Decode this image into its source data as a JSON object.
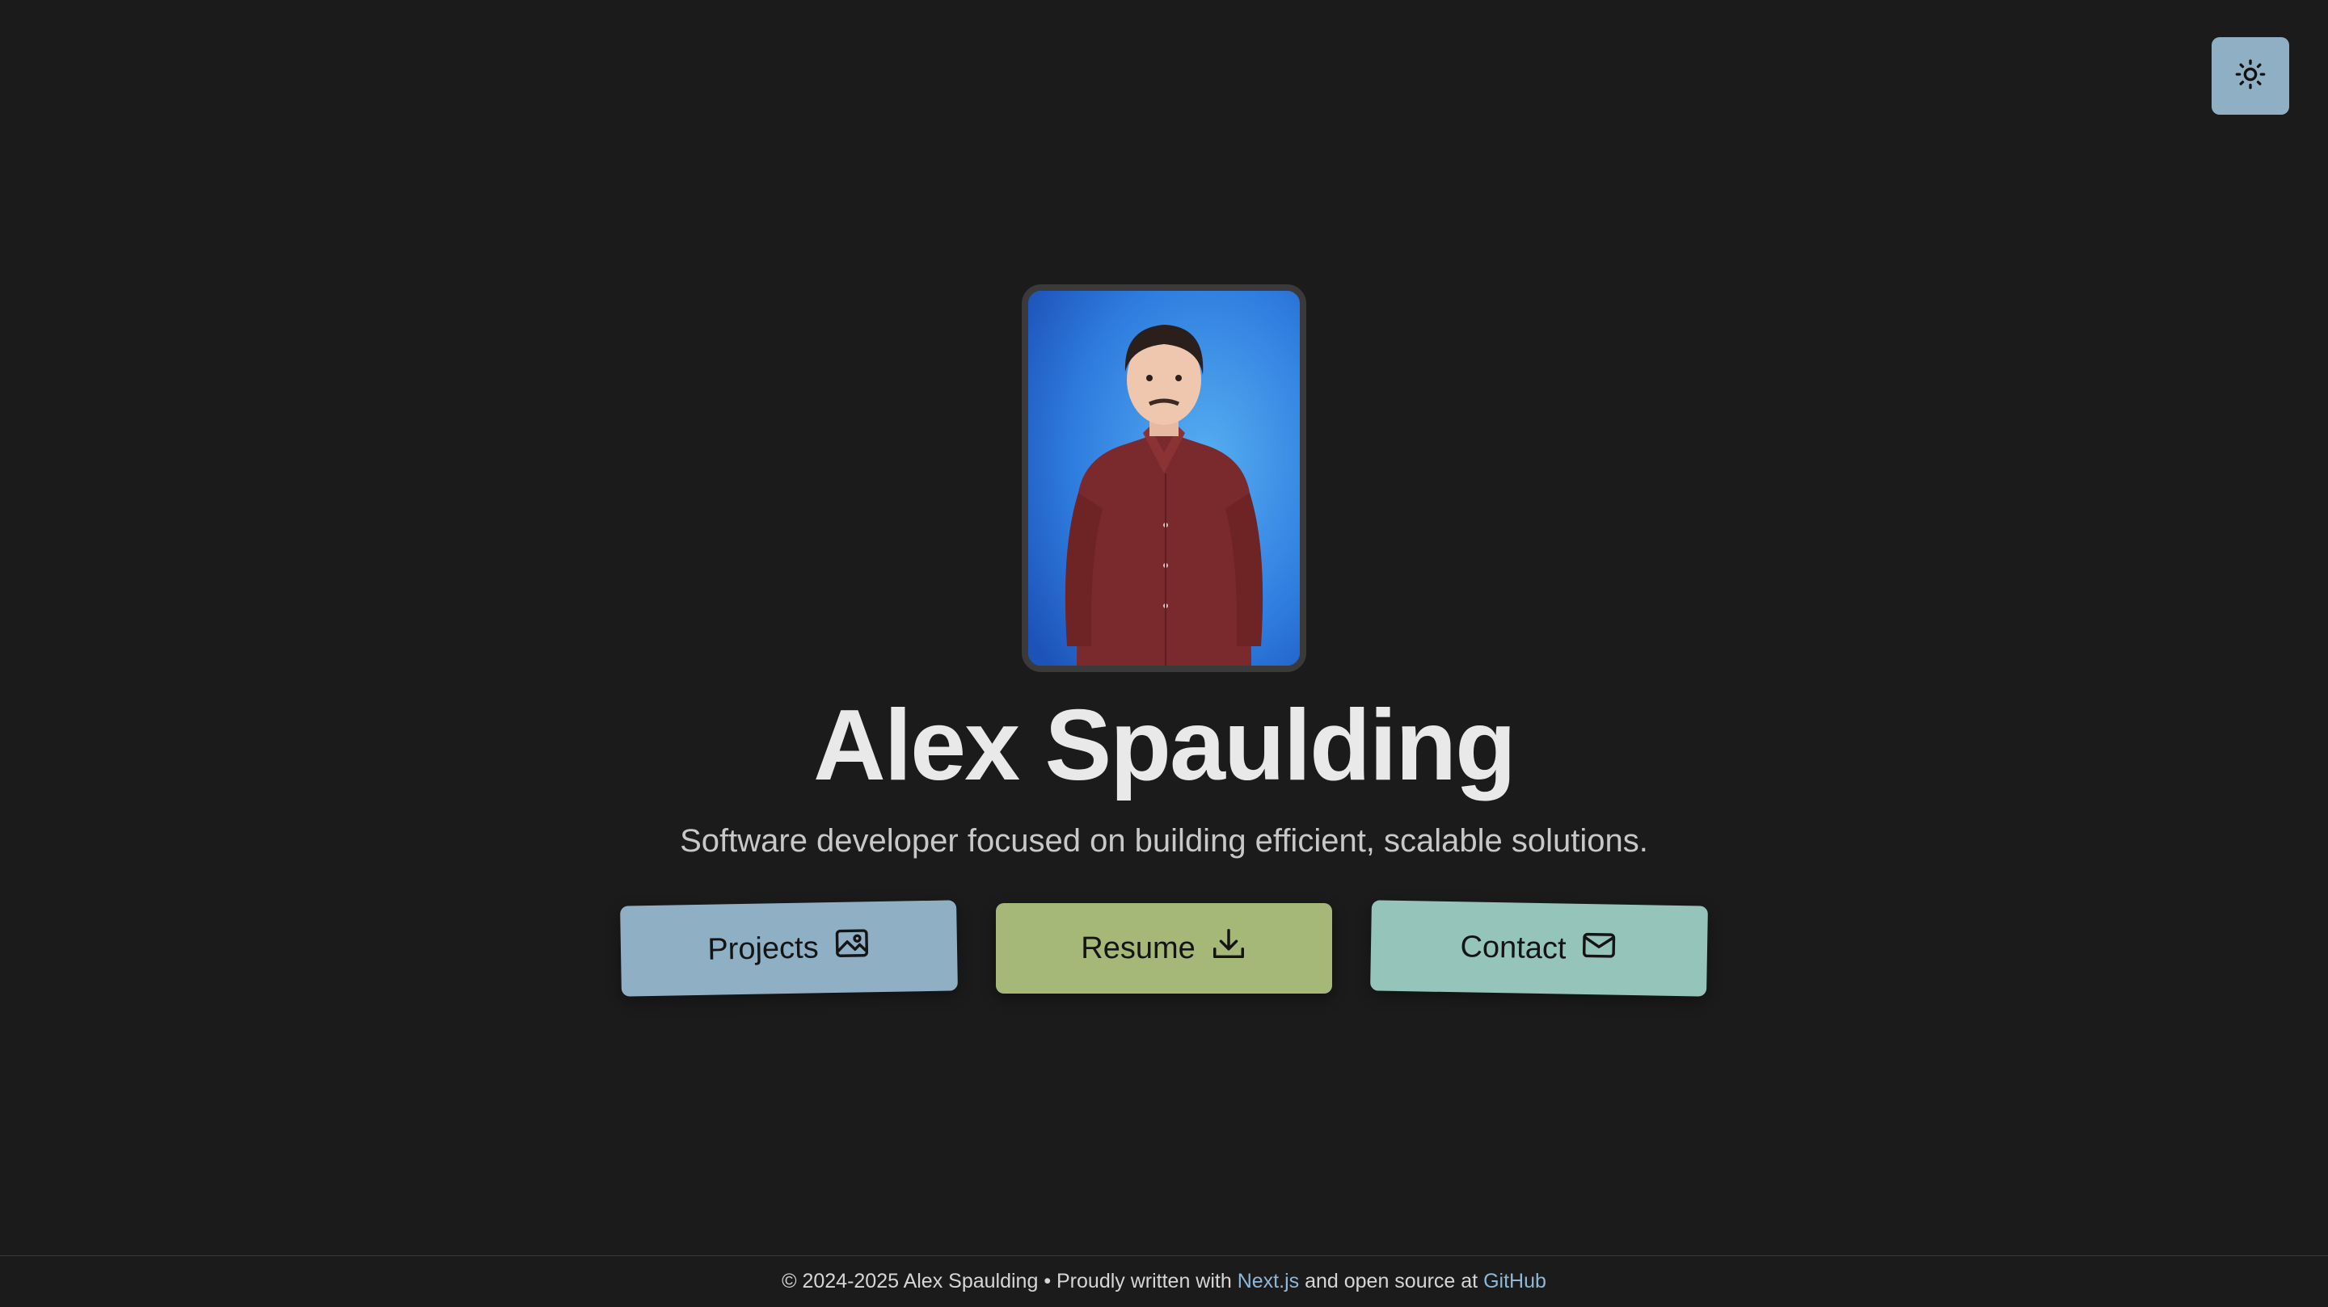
{
  "theme_toggle": {
    "icon": "sun-icon",
    "color": "#8fb0c4"
  },
  "profile": {
    "photo": "portrait-photo",
    "name": "Alex Spaulding",
    "tagline": "Software developer focused on building efficient, scalable solutions."
  },
  "actions": {
    "projects": {
      "label": "Projects",
      "icon": "image-icon",
      "color": "#8fb0c4"
    },
    "resume": {
      "label": "Resume",
      "icon": "download-icon",
      "color": "#a6b877"
    },
    "contact": {
      "label": "Contact",
      "icon": "mail-icon",
      "color": "#94c4ba"
    }
  },
  "footer": {
    "text_before": "© 2024-2025 Alex Spaulding • Proudly written with ",
    "link_nextjs": "Next.js",
    "text_middle": " and open source at ",
    "link_github": "GitHub"
  }
}
